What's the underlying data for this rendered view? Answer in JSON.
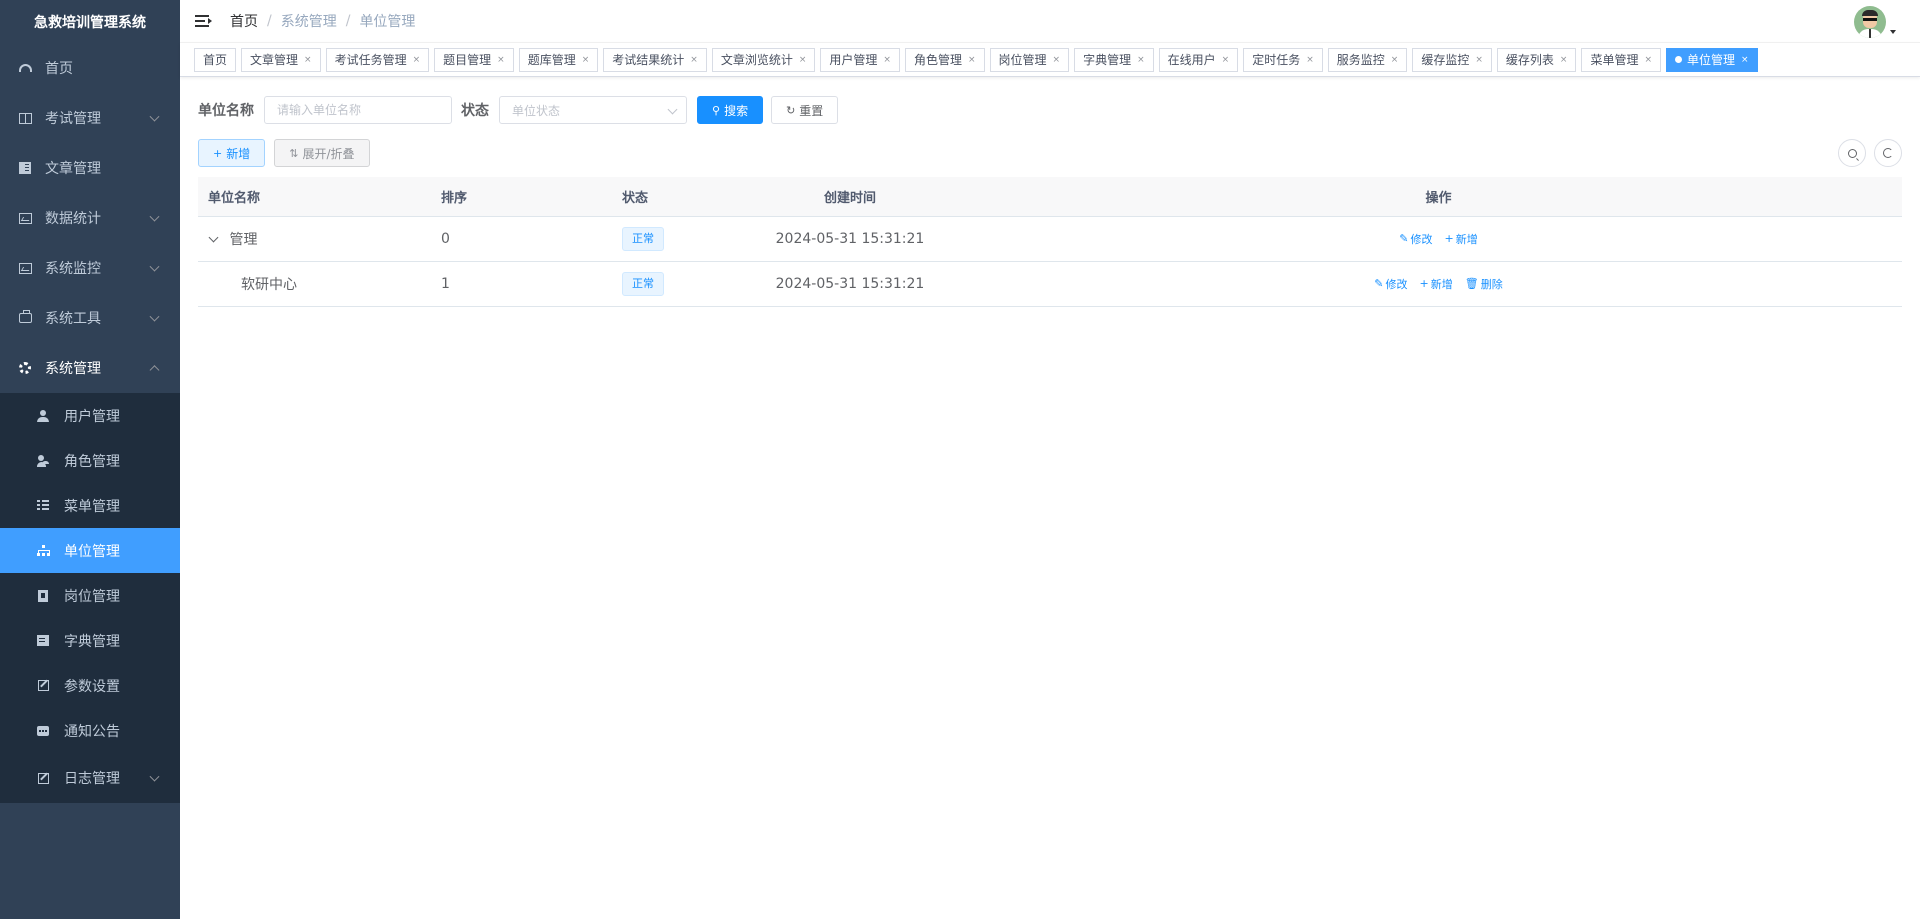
{
  "app": {
    "title": "急救培训管理系统"
  },
  "sidebar": {
    "items": [
      {
        "label": "首页",
        "icon": "dashboard-icon"
      },
      {
        "label": "考试管理",
        "icon": "book-icon",
        "expandable": true
      },
      {
        "label": "文章管理",
        "icon": "document-icon"
      },
      {
        "label": "数据统计",
        "icon": "chart-icon",
        "expandable": true
      },
      {
        "label": "系统监控",
        "icon": "monitor-icon",
        "expandable": true
      },
      {
        "label": "系统工具",
        "icon": "toolbox-icon",
        "expandable": true
      },
      {
        "label": "系统管理",
        "icon": "gear-icon",
        "expandable": true,
        "open": true
      }
    ],
    "system_sub": [
      {
        "label": "用户管理",
        "icon": "user-icon"
      },
      {
        "label": "角色管理",
        "icon": "role-icon"
      },
      {
        "label": "菜单管理",
        "icon": "menu-list-icon"
      },
      {
        "label": "单位管理",
        "icon": "tree-icon",
        "active": true
      },
      {
        "label": "岗位管理",
        "icon": "post-icon"
      },
      {
        "label": "字典管理",
        "icon": "dict-icon"
      },
      {
        "label": "参数设置",
        "icon": "edit-icon"
      },
      {
        "label": "通知公告",
        "icon": "message-icon"
      },
      {
        "label": "日志管理",
        "icon": "log-icon",
        "expandable": true
      }
    ]
  },
  "breadcrumb": [
    "首页",
    "系统管理",
    "单位管理"
  ],
  "tags": [
    {
      "label": "首页",
      "closable": false
    },
    {
      "label": "文章管理",
      "closable": true
    },
    {
      "label": "考试任务管理",
      "closable": true
    },
    {
      "label": "题目管理",
      "closable": true
    },
    {
      "label": "题库管理",
      "closable": true
    },
    {
      "label": "考试结果统计",
      "closable": true
    },
    {
      "label": "文章浏览统计",
      "closable": true
    },
    {
      "label": "用户管理",
      "closable": true
    },
    {
      "label": "角色管理",
      "closable": true
    },
    {
      "label": "岗位管理",
      "closable": true
    },
    {
      "label": "字典管理",
      "closable": true
    },
    {
      "label": "在线用户",
      "closable": true
    },
    {
      "label": "定时任务",
      "closable": true
    },
    {
      "label": "服务监控",
      "closable": true
    },
    {
      "label": "缓存监控",
      "closable": true
    },
    {
      "label": "缓存列表",
      "closable": true
    },
    {
      "label": "菜单管理",
      "closable": true
    },
    {
      "label": "单位管理",
      "closable": true,
      "active": true
    }
  ],
  "search": {
    "name_label": "单位名称",
    "name_placeholder": "请输入单位名称",
    "status_label": "状态",
    "status_placeholder": "单位状态",
    "search_button": "搜索",
    "reset_button": "重置"
  },
  "toolbar": {
    "add_button": "新增",
    "toggle_button": "展开/折叠"
  },
  "table": {
    "columns": [
      "单位名称",
      "排序",
      "状态",
      "创建时间",
      "操作"
    ],
    "rows": [
      {
        "name": "管理",
        "sort": "0",
        "status": "正常",
        "created": "2024-05-31 15:31:21",
        "actions": [
          "修改",
          "新增"
        ],
        "expanded": true,
        "level": 0
      },
      {
        "name": "软研中心",
        "sort": "1",
        "status": "正常",
        "created": "2024-05-31 15:31:21",
        "actions": [
          "修改",
          "新增",
          "删除"
        ],
        "level": 1
      }
    ]
  },
  "colors": {
    "sidebar_bg": "#304156",
    "submenu_bg": "#1f2d3d",
    "accent": "#409eff",
    "primary": "#1890ff"
  }
}
